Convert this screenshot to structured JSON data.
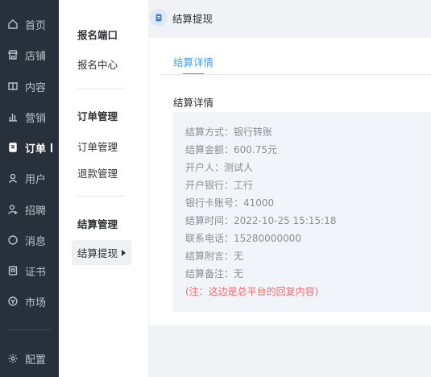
{
  "nav": {
    "items": [
      {
        "label": "首页",
        "icon": "home-icon"
      },
      {
        "label": "店铺",
        "icon": "store-icon"
      },
      {
        "label": "内容",
        "icon": "book-icon"
      },
      {
        "label": "营销",
        "icon": "chart-icon"
      },
      {
        "label": "订单",
        "icon": "order-icon",
        "active": true
      },
      {
        "label": "用户",
        "icon": "user-icon"
      },
      {
        "label": "招聘",
        "icon": "recruit-icon"
      },
      {
        "label": "消息",
        "icon": "message-icon"
      },
      {
        "label": "证书",
        "icon": "certificate-icon"
      },
      {
        "label": "市场",
        "icon": "market-icon"
      }
    ],
    "config": {
      "label": "配置",
      "icon": "gear-icon"
    }
  },
  "submenu": {
    "groups": [
      {
        "heading": "报名端口",
        "items": [
          "报名中心"
        ]
      },
      {
        "heading": "订单管理",
        "items": [
          "订单管理",
          "退款管理"
        ]
      },
      {
        "heading": "结算管理",
        "items": [
          "结算提现"
        ]
      }
    ],
    "active": "结算提现"
  },
  "breadcrumb": {
    "title": "结算提现",
    "icon": "clipboard-icon"
  },
  "card": {
    "tab": "结算详情",
    "section_title": "结算详情",
    "lines": [
      "结算方式：银行转账",
      "结算金额：600.75元",
      "开户人：测试人",
      "开户银行：工行",
      "银行卡账号：41000",
      "结算时间：2022-10-25 15:15:18",
      "联系电话：15280000000",
      "结算附言：无",
      "结算备注：无"
    ],
    "note": "(注：这边是总平台的回复内容)"
  },
  "colors": {
    "rail": "#28303b",
    "accent": "#409eff",
    "note": "#f56c6c"
  }
}
